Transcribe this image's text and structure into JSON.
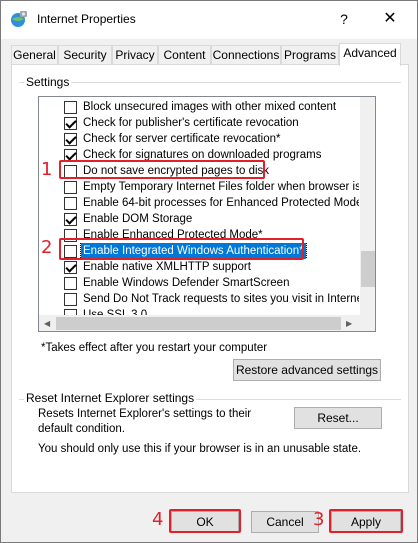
{
  "window": {
    "title": "Internet Properties",
    "help": "?",
    "close": "✕"
  },
  "tabs": [
    "General",
    "Security",
    "Privacy",
    "Content",
    "Connections",
    "Programs",
    "Advanced"
  ],
  "settings_group": "Settings",
  "settings_items": [
    {
      "label": "Block unsecured images with other mixed content",
      "checked": false
    },
    {
      "label": "Check for publisher's certificate revocation",
      "checked": true
    },
    {
      "label": "Check for server certificate revocation*",
      "checked": true
    },
    {
      "label": "Check for signatures on downloaded programs",
      "checked": true
    },
    {
      "label": "Do not save encrypted pages to disk",
      "checked": false
    },
    {
      "label": "Empty Temporary Internet Files folder when browser is clo",
      "checked": false
    },
    {
      "label": "Enable 64-bit processes for Enhanced Protected Mode*",
      "checked": false
    },
    {
      "label": "Enable DOM Storage",
      "checked": true
    },
    {
      "label": "Enable Enhanced Protected Mode*",
      "checked": false
    },
    {
      "label": "Enable Integrated Windows Authentication*",
      "checked": false,
      "selected": true
    },
    {
      "label": "Enable native XMLHTTP support",
      "checked": true
    },
    {
      "label": "Enable Windows Defender SmartScreen",
      "checked": false
    },
    {
      "label": "Send Do Not Track requests to sites you visit in Internet E",
      "checked": false
    },
    {
      "label": "Use SSL 3.0",
      "checked": false
    }
  ],
  "note": "*Takes effect after you restart your computer",
  "restore_button": "Restore advanced settings",
  "reset_group": "Reset Internet Explorer settings",
  "reset_desc": "Resets Internet Explorer's settings to their default condition.",
  "reset_button": "Reset...",
  "reset_warning": "You should only use this if your browser is in an unusable state.",
  "buttons": {
    "ok": "OK",
    "cancel": "Cancel",
    "apply": "Apply"
  },
  "annotations": [
    "1",
    "2",
    "3",
    "4"
  ],
  "colors": {
    "annotation": "#e0202a",
    "selection": "#0078d7"
  }
}
